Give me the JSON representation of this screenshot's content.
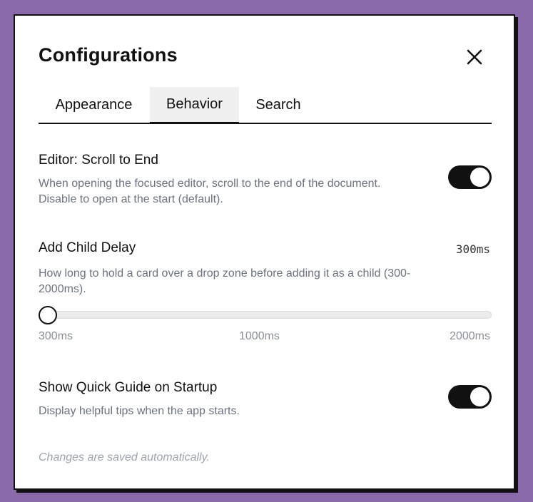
{
  "dialog": {
    "title": "Configurations",
    "close_icon": "close-icon"
  },
  "tabs": [
    {
      "label": "Appearance",
      "active": false
    },
    {
      "label": "Behavior",
      "active": true
    },
    {
      "label": "Search",
      "active": false
    }
  ],
  "settings": {
    "scroll_to_end": {
      "title": "Editor: Scroll to End",
      "description_line1": "When opening the focused editor, scroll to the end of the document.",
      "description_line2": "Disable to open at the start (default).",
      "enabled": true
    },
    "add_child_delay": {
      "title": "Add Child Delay",
      "value_text": "300ms",
      "value": 300,
      "min": 300,
      "max": 2000,
      "description_line1": "How long to hold a card over a drop zone before adding it as a child (300-",
      "description_line2": "2000ms).",
      "min_label": "300ms",
      "mid_label": "1000ms",
      "max_label": "2000ms"
    },
    "quick_guide": {
      "title": "Show Quick Guide on Startup",
      "description": "Display helpful tips when the app starts.",
      "enabled": true
    }
  },
  "footer": {
    "note": "Changes are saved automatically."
  },
  "colors": {
    "backdrop": "#8a6aab",
    "accent": "#111111",
    "muted_text": "#6b7280"
  }
}
